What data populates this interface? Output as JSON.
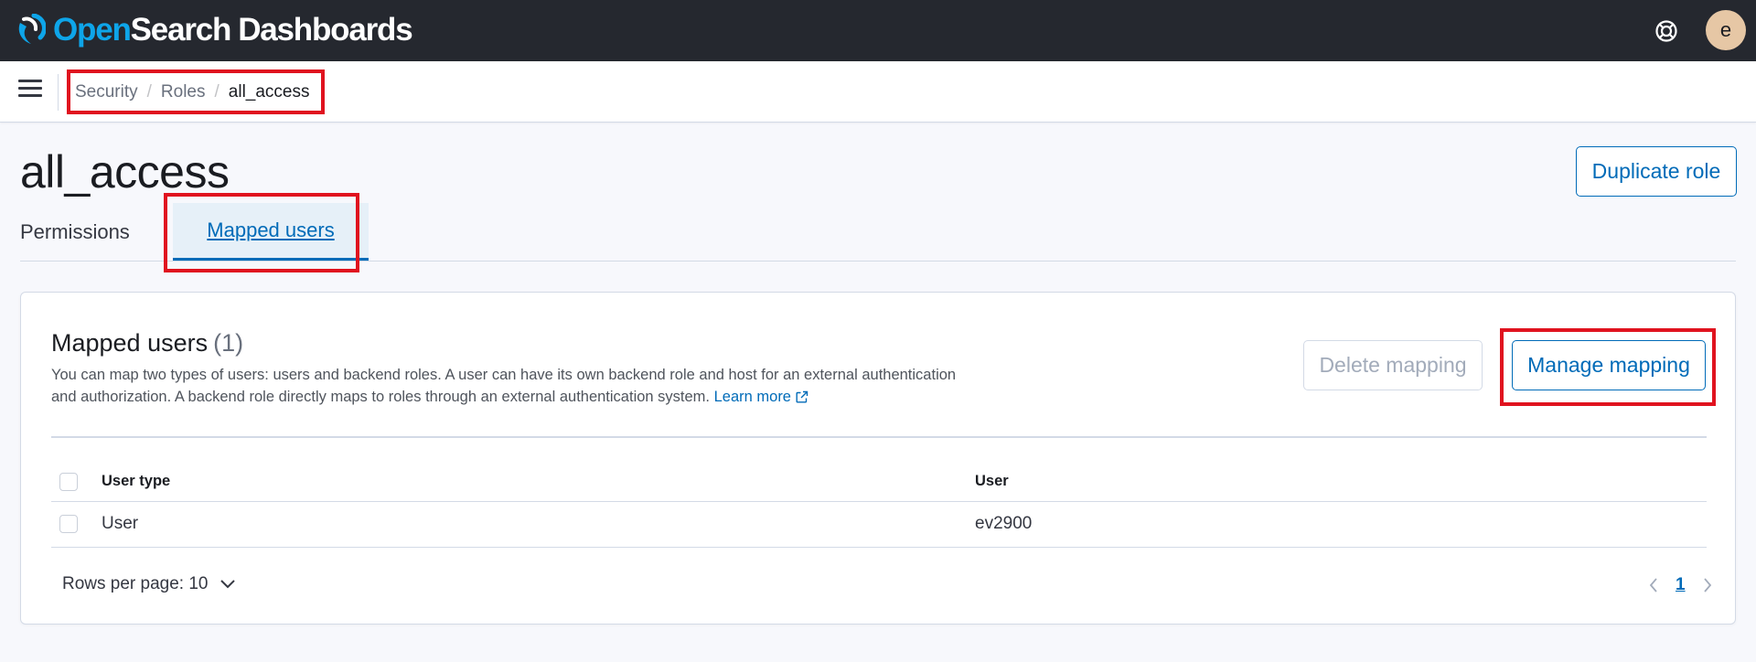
{
  "header": {
    "brand_open": "Open",
    "brand_search": "Search",
    "brand_dashboards": "Dashboards",
    "avatar_initial": "e",
    "help_icon": "help-icon"
  },
  "breadcrumb": {
    "items": [
      "Security",
      "Roles",
      "all_access"
    ],
    "separator": "/"
  },
  "page": {
    "title": "all_access",
    "duplicate_button": "Duplicate role"
  },
  "tabs": [
    {
      "label": "Permissions",
      "active": false
    },
    {
      "label": "Mapped users",
      "active": true
    }
  ],
  "panel": {
    "title": "Mapped users",
    "count": "(1)",
    "description": "You can map two types of users: users and backend roles. A user can have its own backend role and host for an external authentication and authorization. A backend role directly maps to roles through an external authentication system.",
    "learn_more": "Learn more",
    "delete_button": "Delete mapping",
    "manage_button": "Manage mapping",
    "table": {
      "columns": [
        "User type",
        "User"
      ],
      "rows": [
        {
          "user_type": "User",
          "user": "ev2900"
        }
      ]
    },
    "rows_per_page": "Rows per page: 10",
    "current_page": "1"
  },
  "colors": {
    "header_bg": "#25282f",
    "accent": "#006bb8",
    "brand_blue": "#0ea5e9",
    "highlight_red": "#e0131f",
    "avatar_bg": "#e6c7a5"
  }
}
